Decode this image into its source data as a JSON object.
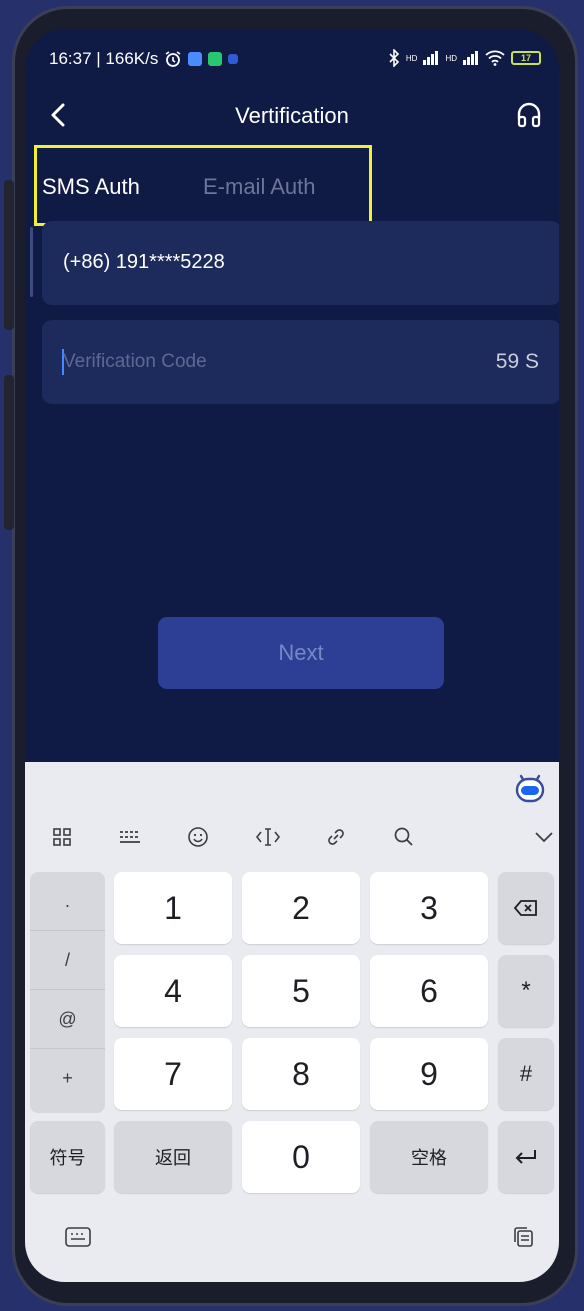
{
  "status_bar": {
    "time_speed": "16:37 | 166K/s",
    "alarm_icon": "alarm-clock-icon",
    "network_left": "HD",
    "network_right": "HD",
    "battery": "17"
  },
  "header": {
    "title": "Vertification",
    "back_icon": "chevron-left-icon",
    "support_icon": "headset-icon"
  },
  "tabs": [
    {
      "label": "SMS Auth",
      "active": true
    },
    {
      "label": "E-mail Auth",
      "active": false
    }
  ],
  "form": {
    "phone_value": "(+86) 191****5228",
    "code_placeholder": "Verification Code",
    "countdown": "59 S",
    "next_label": "Next"
  },
  "keyboard": {
    "toolbar_icons": [
      "grid-icon",
      "keyboard-layout-icon",
      "emoji-icon",
      "cursor-icon",
      "link-icon",
      "search-icon",
      "chevron-down-icon"
    ],
    "symbols": [
      ".",
      "/",
      "@",
      "+"
    ],
    "digits": [
      "1",
      "2",
      "3",
      "4",
      "5",
      "6",
      "7",
      "8",
      "9",
      "0"
    ],
    "right_keys": [
      "*",
      "#"
    ],
    "symbols_key": "符号",
    "back_key": "返回",
    "space_key": "空格"
  },
  "colors": {
    "screen_bg": "#0f1a45",
    "field_bg": "#1d2a5c",
    "highlight": "#f2ef3a",
    "button_bg": "#2c3f95"
  }
}
